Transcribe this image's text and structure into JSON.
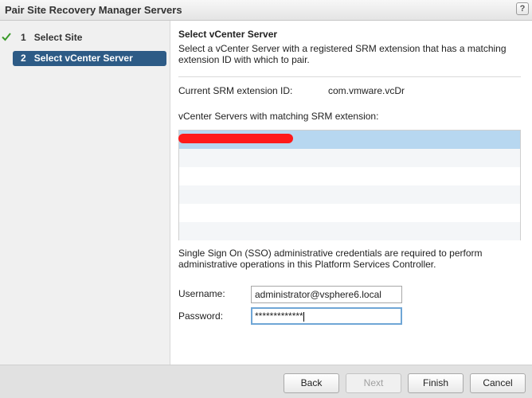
{
  "window": {
    "title": "Pair Site Recovery Manager Servers",
    "help_label": "?"
  },
  "sidebar": {
    "steps": [
      {
        "number": "1",
        "label": "Select Site",
        "status": "done"
      },
      {
        "number": "2",
        "label": "Select vCenter Server",
        "status": "active"
      }
    ]
  },
  "main": {
    "heading": "Select vCenter Server",
    "description": "Select a vCenter Server with a registered SRM extension that has a matching extension ID with which to pair.",
    "extension_label": "Current SRM extension ID:",
    "extension_value": "com.vmware.vcDr",
    "list_label": "vCenter Servers with matching SRM extension:",
    "sso_note": "Single Sign On (SSO) administrative credentials are required to perform administrative operations in this Platform Services Controller.",
    "username_label": "Username:",
    "username_value": "administrator@vsphere6.local",
    "password_label": "Password:",
    "password_value": "*************"
  },
  "footer": {
    "back_label": "Back",
    "next_label": "Next",
    "finish_label": "Finish",
    "cancel_label": "Cancel"
  },
  "colors": {
    "active_step": "#2d5b86",
    "selected_row": "#b7d7f0",
    "redaction": "#ff1a1a",
    "check": "#3a9a2a"
  }
}
